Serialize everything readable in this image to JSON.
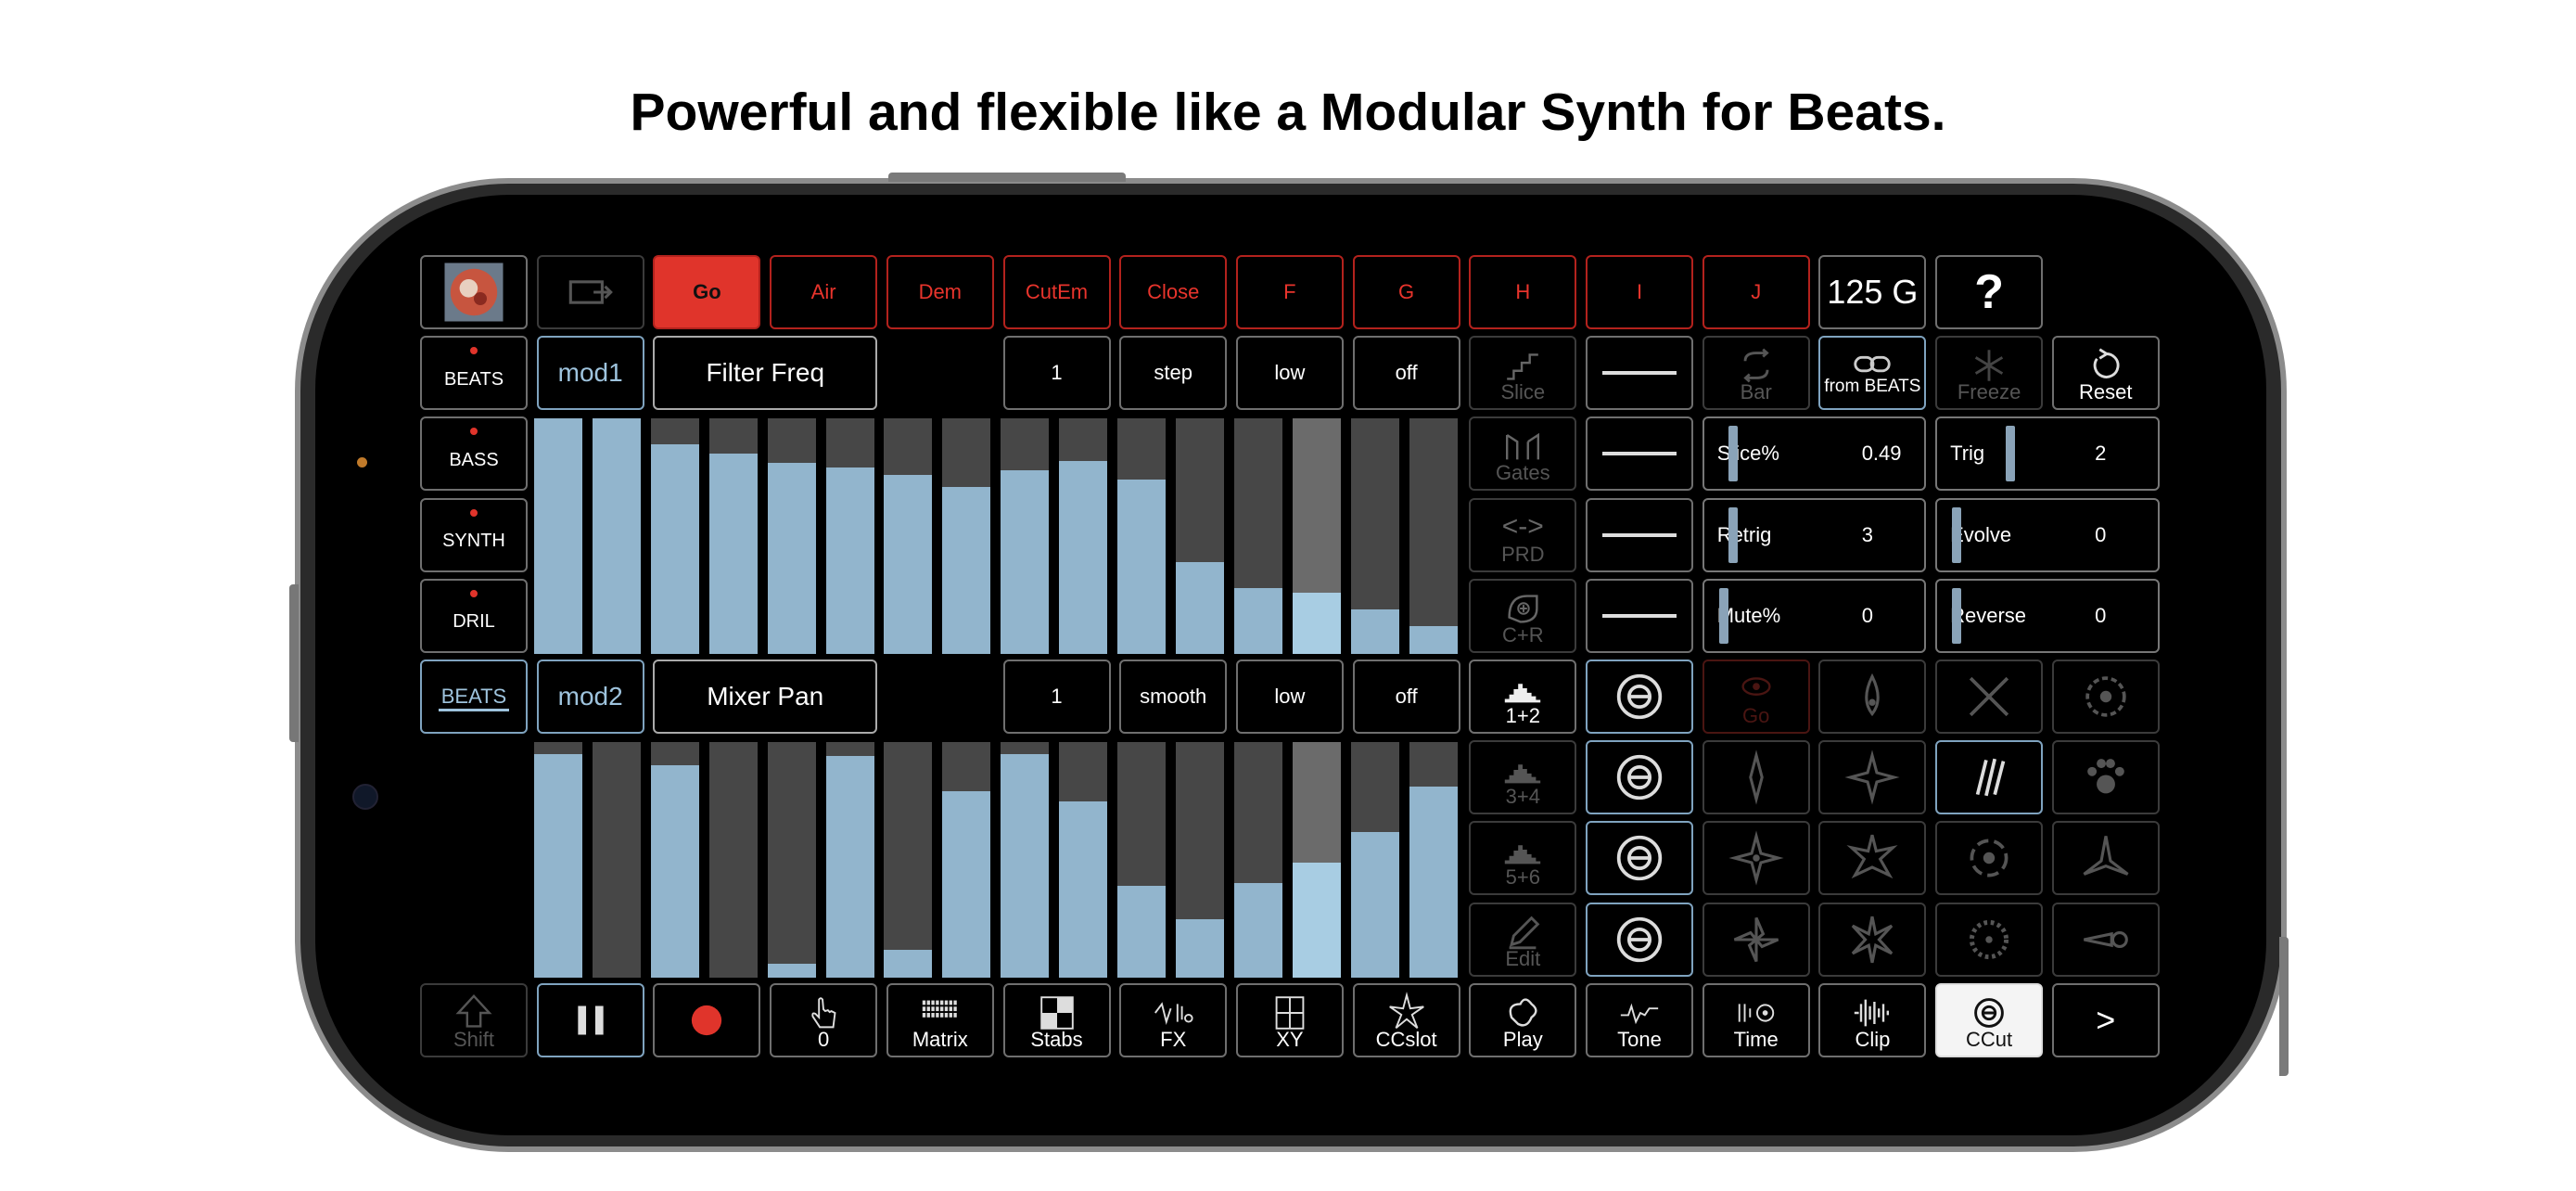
{
  "headline": "Powerful and flexible like a Modular Synth for Beats.",
  "top_row": {
    "scene_buttons": [
      "Go",
      "Air",
      "Dem",
      "CutEm",
      "Close",
      "F",
      "G",
      "H",
      "I",
      "J"
    ],
    "tempo": "125 G",
    "help": "?"
  },
  "tracks": [
    "BEATS",
    "BASS",
    "SYNTH",
    "DRIL"
  ],
  "selected_track": "BEATS",
  "mod1": {
    "name": "mod1",
    "target": "Filter Freq",
    "steps": "1",
    "mode": "step",
    "rate": "low",
    "state": "off",
    "levels": [
      1.0,
      1.0,
      0.89,
      0.85,
      0.81,
      0.79,
      0.76,
      0.71,
      0.78,
      0.82,
      0.74,
      0.39,
      0.28,
      0.26,
      0.19,
      0.12
    ]
  },
  "mod2": {
    "name": "mod2",
    "target": "Mixer Pan",
    "steps": "1",
    "mode": "smooth",
    "rate": "low",
    "state": "off",
    "levels": [
      0.95,
      0.0,
      0.9,
      0.0,
      0.06,
      0.94,
      0.12,
      0.79,
      0.95,
      0.75,
      0.39,
      0.25,
      0.4,
      0.49,
      0.62,
      0.81
    ]
  },
  "slice_tools": {
    "slice": "Slice",
    "gates": "Gates",
    "prd": "PRD",
    "prd_symbol": "<->",
    "cr": "C+R",
    "bar": "Bar",
    "from_beats": "from BEATS",
    "freeze": "Freeze",
    "reset": "Reset"
  },
  "params": [
    {
      "label": "Slice%",
      "value": "0.49",
      "level": 0.1
    },
    {
      "label": "Trig",
      "value": "2",
      "level": 0.5
    },
    {
      "label": "Retrig",
      "value": "3",
      "level": 0.1
    },
    {
      "label": "Evolve",
      "value": "0",
      "level": 0.02
    },
    {
      "label": "Mute%",
      "value": "0",
      "level": 0.02
    },
    {
      "label": "Reverse",
      "value": "0",
      "level": 0.02
    }
  ],
  "pair_buttons": [
    "1+2",
    "3+4",
    "5+6",
    "Edit"
  ],
  "go_dim": "Go",
  "bottom_row": {
    "shift": "Shift",
    "counter": "0",
    "matrix": "Matrix",
    "stabs": "Stabs",
    "fx": "FX",
    "xy": "XY",
    "ccslot": "CCslot",
    "play": "Play",
    "tone": "Tone",
    "time": "Time",
    "clip": "Clip",
    "ccut": "CCut",
    "next": ">"
  },
  "colors": {
    "accent_red": "#e0342b",
    "bar_blue": "#92b5cd",
    "bg": "#000000"
  }
}
